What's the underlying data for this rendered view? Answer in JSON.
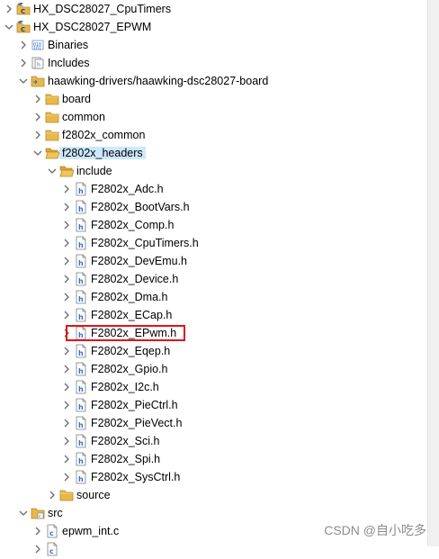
{
  "tree": {
    "rows": [
      {
        "label": "HX_DSC28027_CpuTimers",
        "depth": 0,
        "arrow": "collapsed",
        "icon": "c-project-icon"
      },
      {
        "label": "HX_DSC28027_EPWM",
        "depth": 0,
        "arrow": "expanded",
        "icon": "c-project-icon"
      },
      {
        "label": "Binaries",
        "depth": 1,
        "arrow": "collapsed",
        "icon": "binaries-icon"
      },
      {
        "label": "Includes",
        "depth": 1,
        "arrow": "collapsed",
        "icon": "includes-icon"
      },
      {
        "label": "haawking-drivers/haawking-dsc28027-board",
        "depth": 1,
        "arrow": "expanded",
        "icon": "linked-folder-icon"
      },
      {
        "label": "board",
        "depth": 2,
        "arrow": "collapsed",
        "icon": "folder-icon"
      },
      {
        "label": "common",
        "depth": 2,
        "arrow": "collapsed",
        "icon": "folder-icon"
      },
      {
        "label": "f2802x_common",
        "depth": 2,
        "arrow": "collapsed",
        "icon": "folder-icon"
      },
      {
        "label": "f2802x_headers",
        "depth": 2,
        "arrow": "expanded",
        "icon": "folder-open-icon",
        "selected": true
      },
      {
        "label": "include",
        "depth": 3,
        "arrow": "expanded",
        "icon": "folder-open-icon"
      },
      {
        "label": "F2802x_Adc.h",
        "depth": 4,
        "arrow": "collapsed",
        "icon": "header-file-icon"
      },
      {
        "label": "F2802x_BootVars.h",
        "depth": 4,
        "arrow": "collapsed",
        "icon": "header-file-icon"
      },
      {
        "label": "F2802x_Comp.h",
        "depth": 4,
        "arrow": "collapsed",
        "icon": "header-file-icon"
      },
      {
        "label": "F2802x_CpuTimers.h",
        "depth": 4,
        "arrow": "collapsed",
        "icon": "header-file-icon"
      },
      {
        "label": "F2802x_DevEmu.h",
        "depth": 4,
        "arrow": "collapsed",
        "icon": "header-file-icon"
      },
      {
        "label": "F2802x_Device.h",
        "depth": 4,
        "arrow": "collapsed",
        "icon": "header-file-icon"
      },
      {
        "label": "F2802x_Dma.h",
        "depth": 4,
        "arrow": "collapsed",
        "icon": "header-file-icon"
      },
      {
        "label": "F2802x_ECap.h",
        "depth": 4,
        "arrow": "collapsed",
        "icon": "header-file-icon"
      },
      {
        "label": "F2802x_EPwm.h",
        "depth": 4,
        "arrow": "collapsed",
        "icon": "header-file-icon",
        "highlighted": true
      },
      {
        "label": "F2802x_Eqep.h",
        "depth": 4,
        "arrow": "collapsed",
        "icon": "header-file-icon"
      },
      {
        "label": "F2802x_Gpio.h",
        "depth": 4,
        "arrow": "collapsed",
        "icon": "header-file-icon"
      },
      {
        "label": "F2802x_I2c.h",
        "depth": 4,
        "arrow": "collapsed",
        "icon": "header-file-icon"
      },
      {
        "label": "F2802x_PieCtrl.h",
        "depth": 4,
        "arrow": "collapsed",
        "icon": "header-file-icon"
      },
      {
        "label": "F2802x_PieVect.h",
        "depth": 4,
        "arrow": "collapsed",
        "icon": "header-file-icon"
      },
      {
        "label": "F2802x_Sci.h",
        "depth": 4,
        "arrow": "collapsed",
        "icon": "header-file-icon"
      },
      {
        "label": "F2802x_Spi.h",
        "depth": 4,
        "arrow": "collapsed",
        "icon": "header-file-icon"
      },
      {
        "label": "F2802x_SysCtrl.h",
        "depth": 4,
        "arrow": "collapsed",
        "icon": "header-file-icon"
      },
      {
        "label": "source",
        "depth": 3,
        "arrow": "collapsed",
        "icon": "folder-icon"
      },
      {
        "label": "src",
        "depth": 1,
        "arrow": "expanded",
        "icon": "source-folder-icon"
      },
      {
        "label": "epwm_int.c",
        "depth": 2,
        "arrow": "collapsed",
        "icon": "c-file-icon"
      },
      {
        "label": "",
        "depth": 2,
        "arrow": "collapsed",
        "icon": "c-file-icon"
      }
    ]
  },
  "colors": {
    "selection": "#cce8ff",
    "highlight_box": "#e0131a",
    "folder": "#e8b84a",
    "arrow": "#6b6b6b"
  },
  "watermark": "CSDN @自小吃多"
}
